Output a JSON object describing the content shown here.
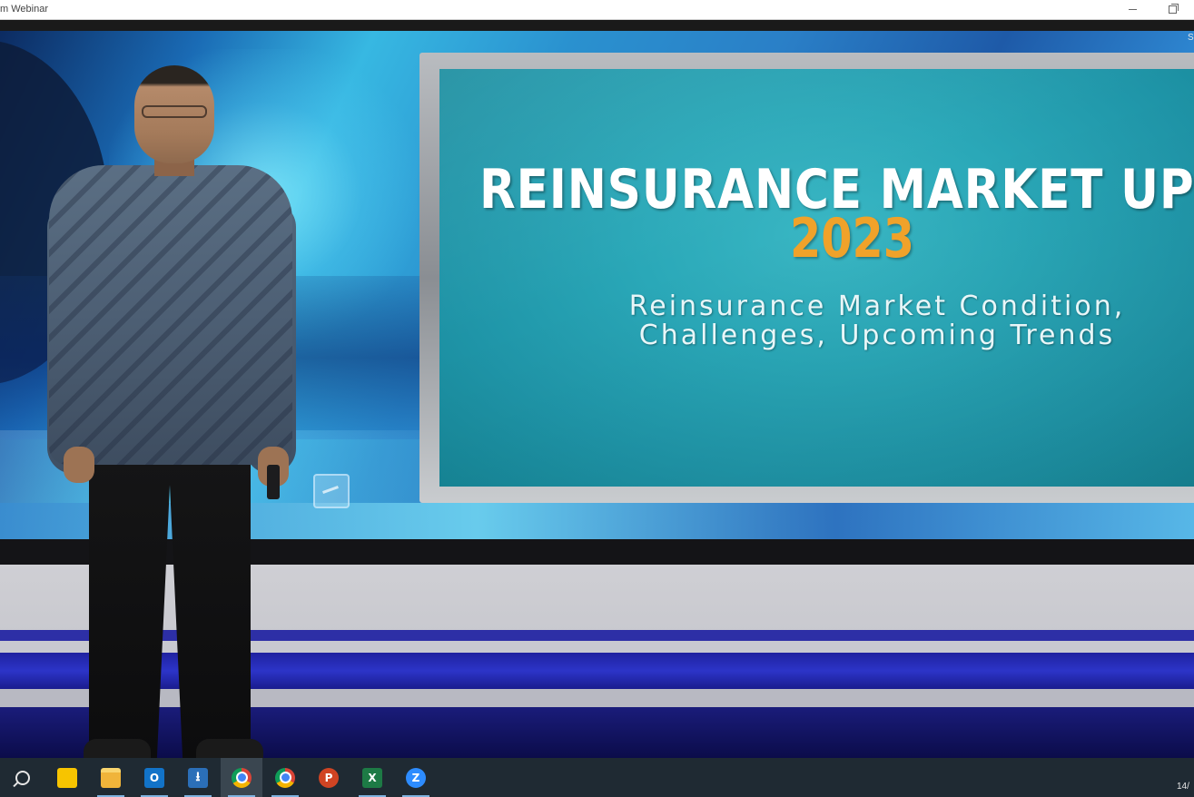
{
  "window": {
    "title": "m Webinar",
    "corner_tag": "S"
  },
  "slide": {
    "title": "REINSURANCE MARKET UPDAT",
    "year": "2023",
    "subtitle_line1": "Reinsurance Market Condition,",
    "subtitle_line2": "Challenges, Upcoming Trends"
  },
  "taskbar": {
    "items": [
      {
        "name": "search-icon",
        "label": ""
      },
      {
        "name": "sticky-notes-icon",
        "label": "",
        "color": "#f7c400"
      },
      {
        "name": "file-explorer-icon",
        "label": "",
        "color": "#f0b43a"
      },
      {
        "name": "outlook-icon",
        "label": "O",
        "color": "#1273c8"
      },
      {
        "name": "download-app-icon",
        "label": "",
        "color": "#2b6fb8"
      },
      {
        "name": "chrome-icon",
        "label": "",
        "color": "#db4437"
      },
      {
        "name": "chrome-profile-icon",
        "label": "",
        "color": "#4285f4"
      },
      {
        "name": "powerpoint-icon",
        "label": "P",
        "color": "#d04423"
      },
      {
        "name": "excel-icon",
        "label": "X",
        "color": "#1d7a45"
      },
      {
        "name": "zoom-icon",
        "label": "Z",
        "color": "#2d8cff"
      }
    ],
    "clock": "14/"
  }
}
